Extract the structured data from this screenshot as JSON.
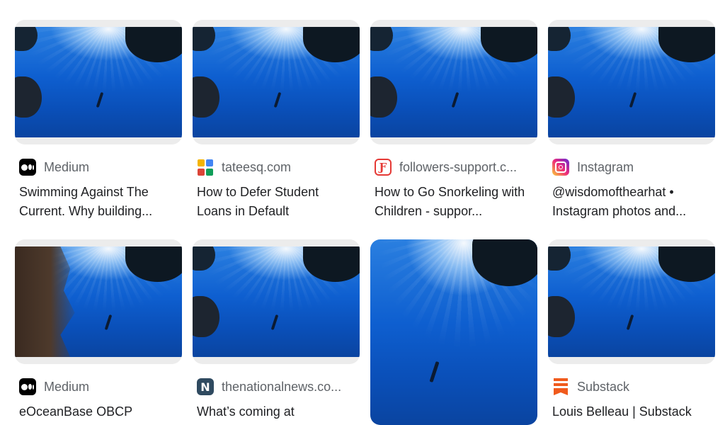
{
  "results": [
    {
      "source": "Medium",
      "favicon": "medium-icon",
      "title": "Swimming Against The Current. Why building..."
    },
    {
      "source": "tateesq.com",
      "favicon": "tateesq-icon",
      "title": "How to Defer Student Loans in Default"
    },
    {
      "source": "followers-support.c...",
      "favicon": "followers-support-icon",
      "title": "How to Go Snorkeling with Children - suppor..."
    },
    {
      "source": "Instagram",
      "favicon": "instagram-icon",
      "title": "@wisdomofthearhat • Instagram photos and..."
    },
    {
      "source": "Medium",
      "favicon": "medium-icon",
      "title": "eOceanBase OBCP"
    },
    {
      "source": "thenationalnews.co...",
      "favicon": "thenationalnews-icon",
      "title": "What’s coming at"
    },
    {
      "source": "",
      "favicon": "",
      "title": ""
    },
    {
      "source": "Substack",
      "favicon": "substack-icon",
      "title": "Louis Belleau | Substack"
    }
  ],
  "favicons": {
    "followers_letter": "Ƒ",
    "national_letter": "N"
  },
  "colors": {
    "ocean_blue": "#0e5fd0",
    "medium": "#000000",
    "substack": "#f05a1c",
    "followers": "#e53935",
    "nationalnews": "#2f4a60"
  }
}
